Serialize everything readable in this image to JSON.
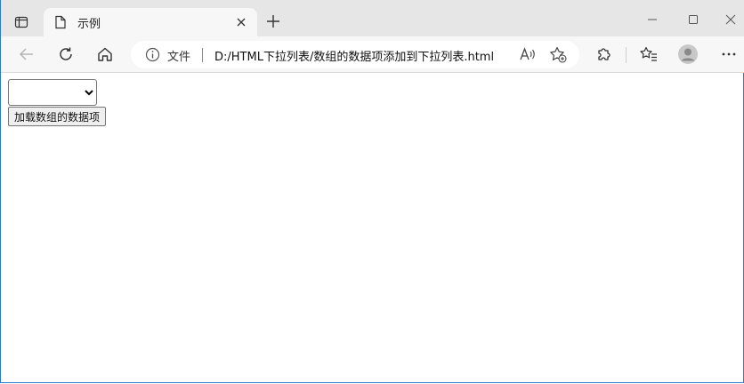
{
  "browser": {
    "tab": {
      "title": "示例"
    },
    "address_bar": {
      "file_label": "文件",
      "url": "D:/HTML下拉列表/数组的数据项添加到下拉列表.html"
    }
  },
  "page": {
    "select": {
      "selected_value": ""
    },
    "load_button_label": "加载数组的数据项"
  },
  "colors": {
    "window_border": "#2b79d0",
    "tab_strip": "#e6e6e6",
    "toolbar": "#f7f7f7"
  }
}
